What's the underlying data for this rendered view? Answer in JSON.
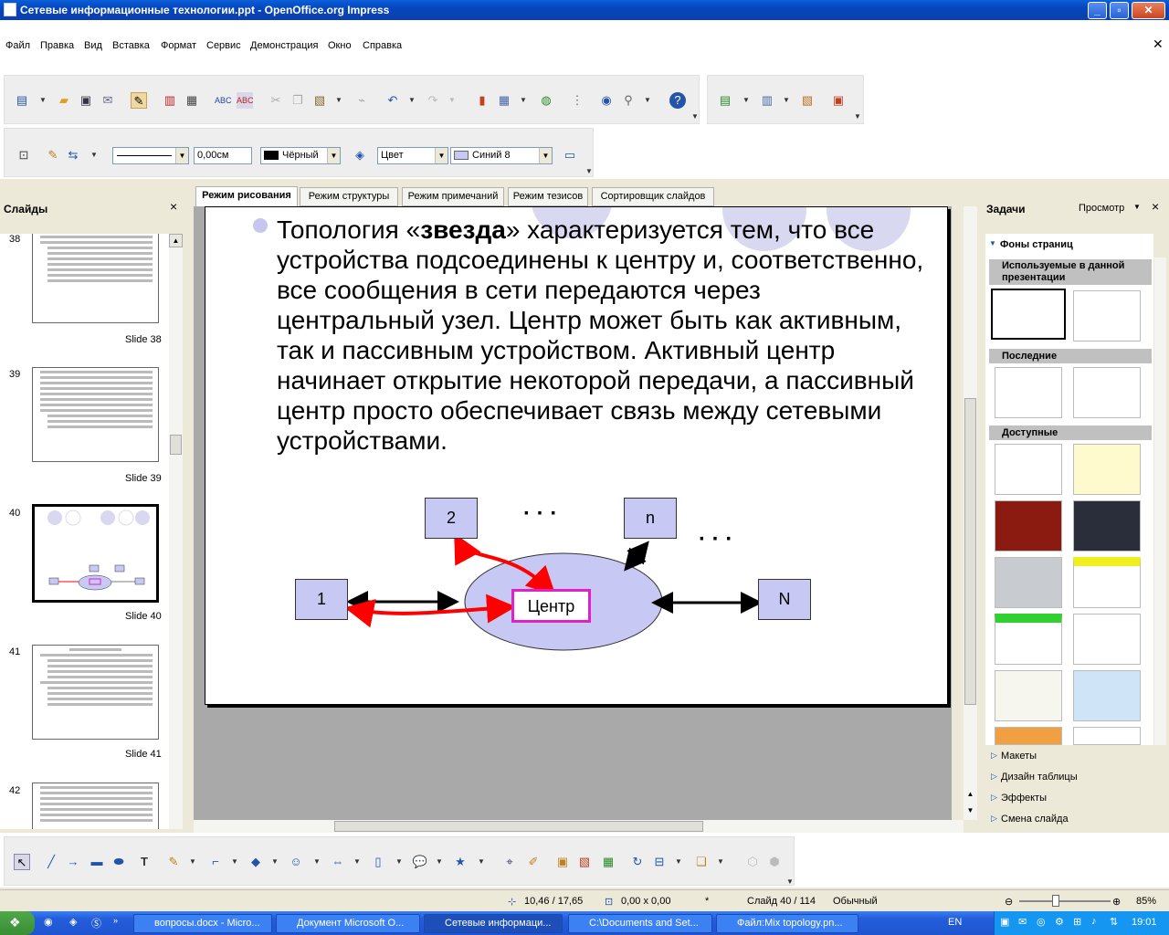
{
  "window": {
    "title": "Сетевые информационные технологии.ppt - OpenOffice.org Impress"
  },
  "menu": {
    "items": [
      "Файл",
      "Правка",
      "Вид",
      "Вставка",
      "Формат",
      "Сервис",
      "Демонстрация",
      "Окно",
      "Справка"
    ]
  },
  "line_toolbar": {
    "width_value": "0,00см",
    "line_color": "Чёрный",
    "area_style": "Цвет",
    "area_color": "Синий 8"
  },
  "slides_panel": {
    "title": "Слайды",
    "close": "×",
    "slides": [
      {
        "num": "38",
        "label": "Slide 38"
      },
      {
        "num": "39",
        "label": "Slide 39"
      },
      {
        "num": "40",
        "label": "Slide 40"
      },
      {
        "num": "41",
        "label": "Slide 41"
      },
      {
        "num": "42",
        "label": ""
      }
    ]
  },
  "view_tabs": [
    "Режим рисования",
    "Режим структуры",
    "Режим примечаний",
    "Режим тезисов",
    "Сортировщик слайдов"
  ],
  "slide": {
    "para_pre": "Топология «",
    "para_bold": "звезда",
    "para_post": "» характеризуется тем, что все устройства подсоединены к центру и, соответственно, все сообщения в сети передаются через центральный узел. Центр может быть как активным, так и пассивным устройством. Активный центр начинает открытие некоторой передачи, а пассивный центр просто обеспечивает связь между сетевыми устройствами.",
    "diagram": {
      "node_1": "1",
      "node_2": "2",
      "node_n": "n",
      "node_N": "N",
      "center": "Центр",
      "dots": "· · ·"
    }
  },
  "task_panel": {
    "title": "Задачи",
    "view_label": "Просмотр",
    "close": "×",
    "section": "Фоны страниц",
    "used": "Используемые в данной презентации",
    "recent": "Последние",
    "available": "Доступные",
    "links": [
      "Макеты",
      "Дизайн таблицы",
      "Эффекты",
      "Смена слайда"
    ]
  },
  "statusbar": {
    "position": "10,46 / 17,65",
    "size": "0,00 x 0,00",
    "modified": "*",
    "slide": "Слайд 40 / 114",
    "layout": "Обычный",
    "zoom": "85%"
  },
  "taskbar": {
    "items": [
      "вопросы.docx - Micro...",
      "Документ Microsoft O...",
      "Сетевые информаци...",
      "C:\\Documents and Set...",
      "Файл:Mix topology.pn..."
    ],
    "lang": "EN",
    "clock": "19:01"
  },
  "colors": {
    "title_bar": "#0a5fd8",
    "node_fill": "#c8c8f4",
    "center_border": "#e020c8",
    "arrow_red": "#ff0000"
  }
}
